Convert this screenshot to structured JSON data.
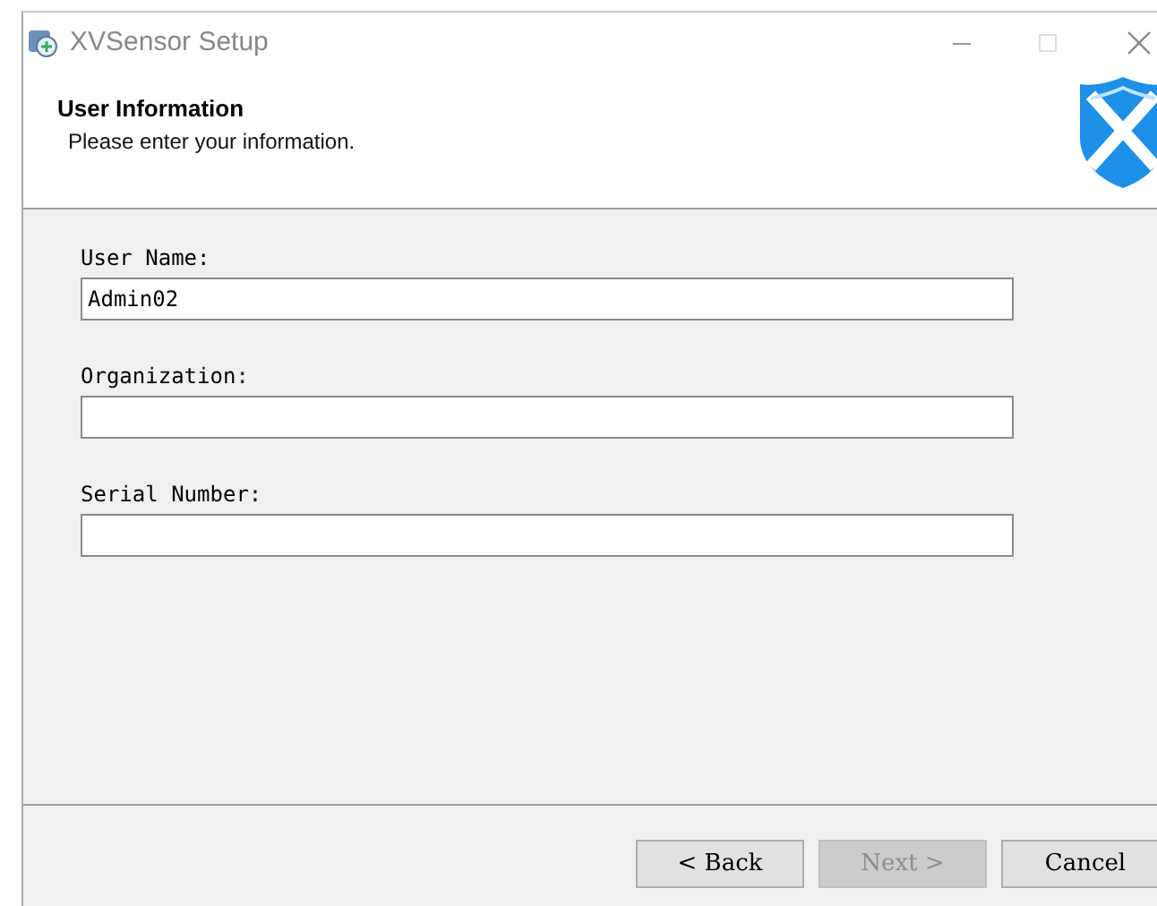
{
  "window": {
    "title": "XVSensor Setup"
  },
  "header": {
    "title": "User Information",
    "subtitle": "Please enter your information."
  },
  "fields": [
    {
      "label": "User Name:",
      "value": "Admin02"
    },
    {
      "label": "Organization:"
    },
    {
      "label": "Serial Number:"
    }
  ],
  "buttons": [
    {
      "label": "< Back",
      "disabled": false
    },
    {
      "label": "Next >",
      "disabled": true
    },
    {
      "label": "Cancel",
      "disabled": false
    }
  ]
}
